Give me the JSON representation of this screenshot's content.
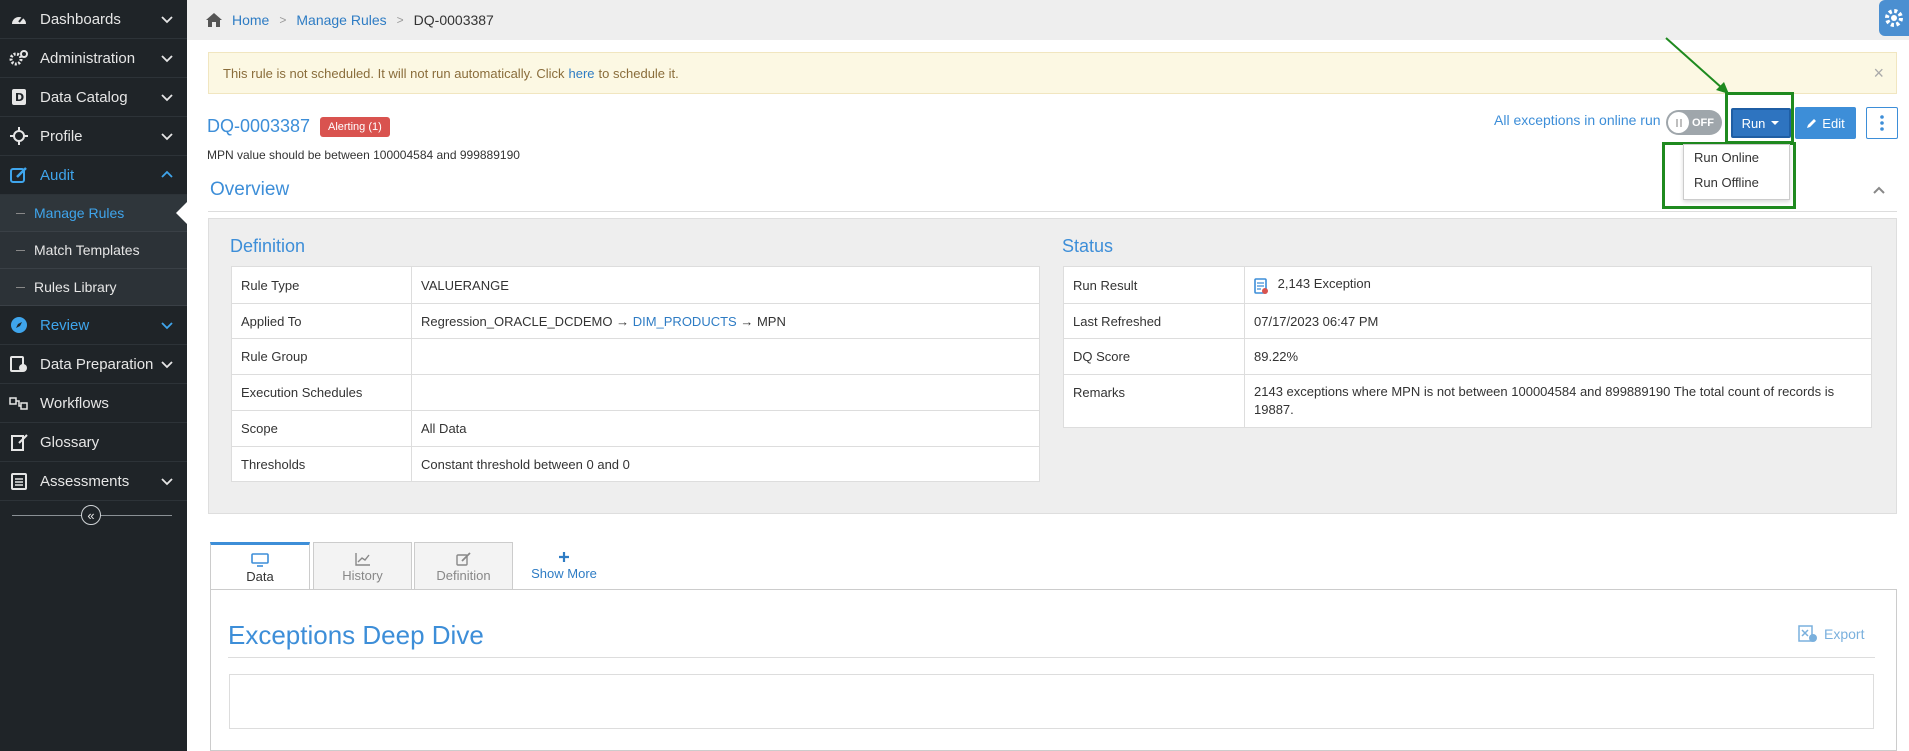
{
  "sidebar": {
    "items": [
      {
        "label": "Dashboards"
      },
      {
        "label": "Administration"
      },
      {
        "label": "Data Catalog"
      },
      {
        "label": "Profile"
      },
      {
        "label": "Audit"
      },
      {
        "label": "Review"
      },
      {
        "label": "Data Preparation"
      },
      {
        "label": "Workflows"
      },
      {
        "label": "Glossary"
      },
      {
        "label": "Assessments"
      }
    ],
    "sub_items": [
      {
        "label": "Manage Rules"
      },
      {
        "label": "Match Templates"
      },
      {
        "label": "Rules Library"
      }
    ],
    "collapse_glyph": "«"
  },
  "breadcrumb": {
    "home": "Home",
    "manage_rules": "Manage Rules",
    "current": "DQ-0003387"
  },
  "alert": {
    "text_before": "This rule is not scheduled. It will not run automatically. Click",
    "link": "here",
    "text_after": "to schedule it.",
    "close": "×"
  },
  "rule": {
    "id": "DQ-0003387",
    "badge": "Alerting (1)",
    "description": "MPN value should be between 100004584 and 999889190"
  },
  "actions": {
    "online_label": "All exceptions in online run",
    "toggle_state": "OFF",
    "run_label": "Run",
    "edit_label": "Edit",
    "menu": [
      "Run Online",
      "Run Offline"
    ]
  },
  "overview": {
    "title": "Overview"
  },
  "definition": {
    "title": "Definition",
    "rule_type_label": "Rule Type",
    "rule_type_value": "VALUERANGE",
    "applied_to_label": "Applied To",
    "applied_source": "Regression_ORACLE_DCDEMO",
    "applied_arrow": "→",
    "applied_table": "DIM_PRODUCTS",
    "applied_column": "MPN",
    "rule_group_label": "Rule Group",
    "rule_group_value": "",
    "exec_sched_label": "Execution Schedules",
    "exec_sched_value": "",
    "scope_label": "Scope",
    "scope_value": "All Data",
    "thresholds_label": "Thresholds",
    "thresholds_value": "Constant threshold between 0 and 0"
  },
  "status": {
    "title": "Status",
    "run_result_label": "Run Result",
    "run_result_count": "2,143",
    "run_result_text": "Exception",
    "last_refreshed_label": "Last Refreshed",
    "last_refreshed_value": "07/17/2023 06:47 PM",
    "dq_score_label": "DQ Score",
    "dq_score_value": "89.22%",
    "remarks_label": "Remarks",
    "remarks_value": "2143 exceptions where MPN is not between 100004584 and 899889190 The total count of records is 19887."
  },
  "tabs": [
    {
      "label": "Data"
    },
    {
      "label": "History"
    },
    {
      "label": "Definition"
    }
  ],
  "show_more": "Show More",
  "deep_dive": {
    "title": "Exceptions Deep Dive",
    "export": "Export"
  }
}
